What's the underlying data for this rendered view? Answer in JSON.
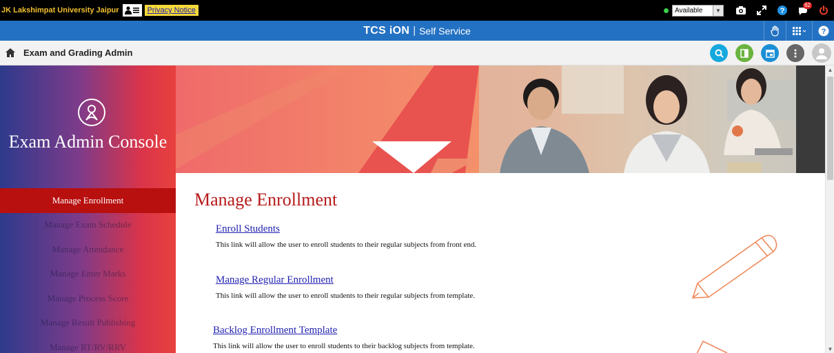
{
  "topbar": {
    "org_name": "JK Lakshimpat University Jaipur",
    "privacy_label": "Privacy Notice",
    "status_value": "Available",
    "notification_count": "62"
  },
  "brand": {
    "logo_text": "TCS iON",
    "separator": "|",
    "subtitle": "Self Service"
  },
  "breadcrumb": {
    "title": "Exam and Grading Admin"
  },
  "sidebar": {
    "console_title": "Exam Admin Console",
    "items": [
      {
        "label": "Manage Enrollment",
        "active": true
      },
      {
        "label": "Manage Exam Schedule",
        "active": false
      },
      {
        "label": "Manage Attendance",
        "active": false
      },
      {
        "label": "Manage Enter Marks",
        "active": false
      },
      {
        "label": "Manage Process Score",
        "active": false
      },
      {
        "label": "Manage Result Publishing",
        "active": false
      },
      {
        "label": "Manage RT/RV/RRV",
        "active": false
      }
    ]
  },
  "main": {
    "title": "Manage Enrollment",
    "links": [
      {
        "label": "Enroll Students",
        "description": "This link will allow the user to enroll students to their regular subjects from front end."
      },
      {
        "label": "Manage Regular Enrollment",
        "description": "This link will allow the user to enroll students to their regular subjects from template."
      },
      {
        "label": "Backlog Enrollment Template",
        "description": "This link will allow the user to enroll students to their backlog subjects from template."
      }
    ]
  },
  "colors": {
    "topbar_bg": "#000000",
    "brand_bar": "#2371c2",
    "active_menu": "#b80f0f",
    "title_red": "#b51a1a",
    "link_blue": "#1f1fb0"
  },
  "icons": [
    "user-card-icon",
    "camera-icon",
    "expand-icon",
    "help-icon",
    "notification-icon",
    "power-icon",
    "hand-icon",
    "grid-apps-icon",
    "home-icon",
    "search-icon",
    "panel-icon",
    "calendar-icon",
    "more-icon",
    "avatar-icon",
    "console-user-icon",
    "pencil-illustration-icon"
  ]
}
